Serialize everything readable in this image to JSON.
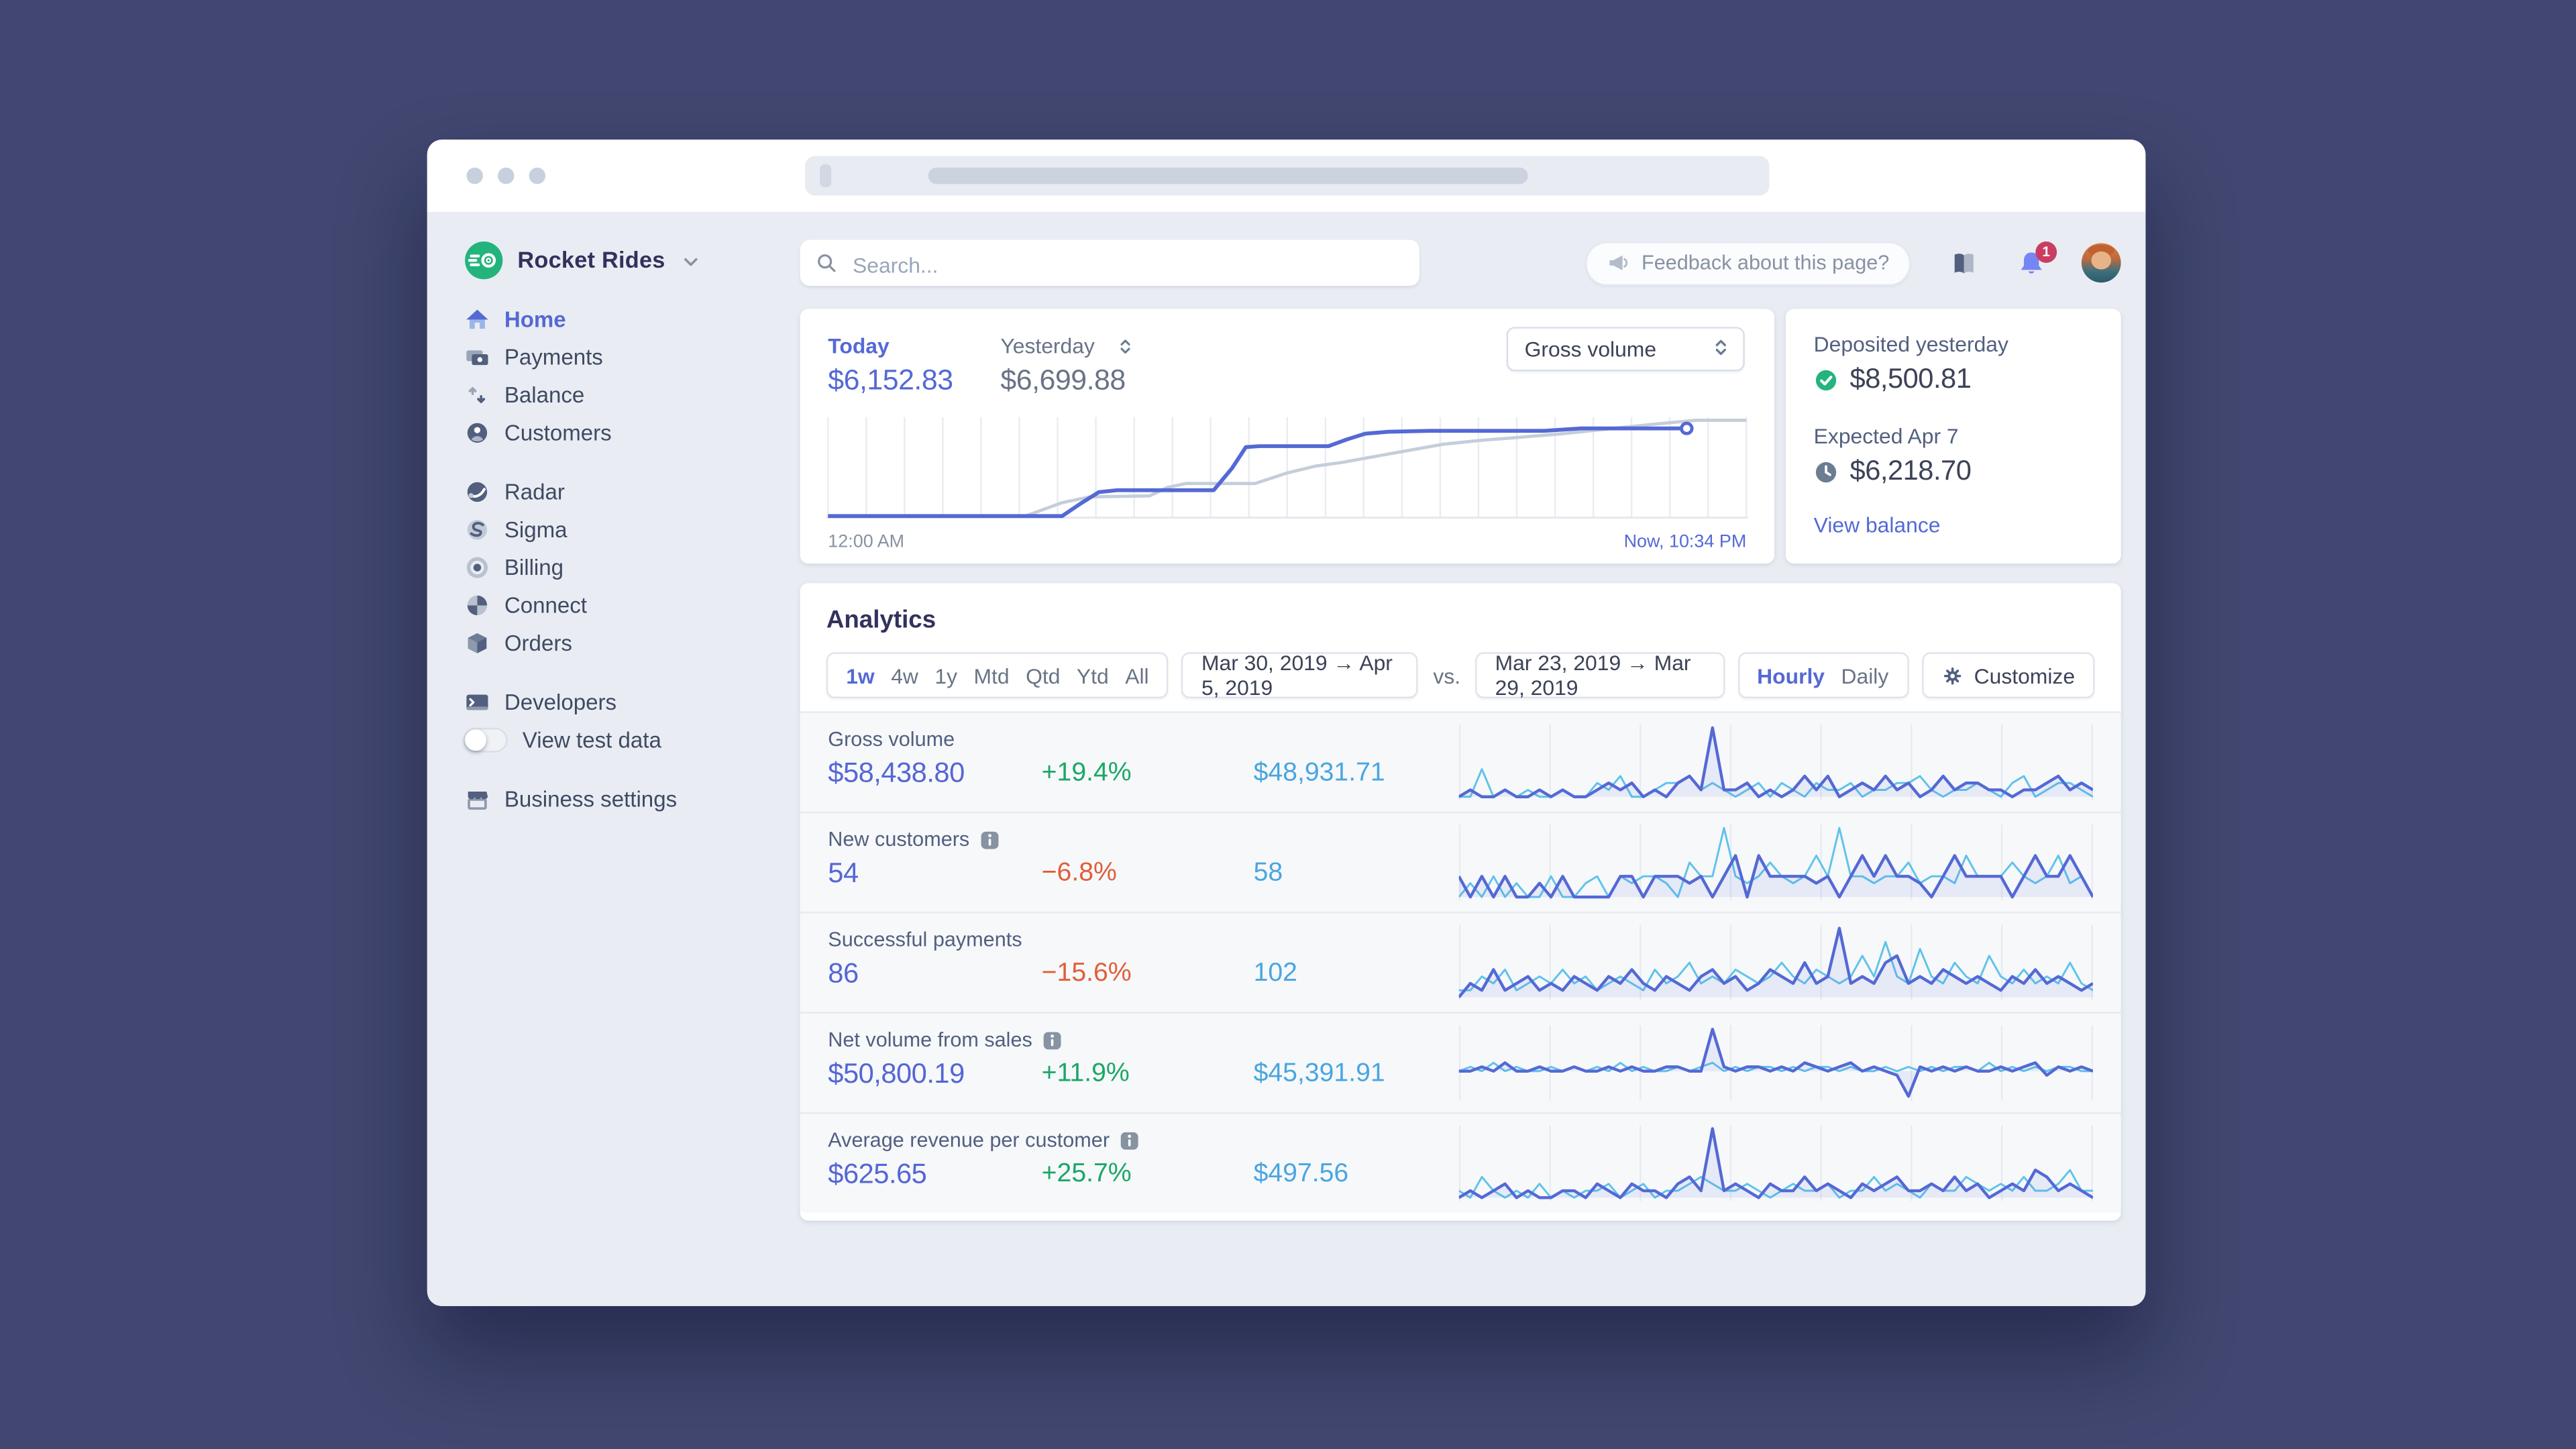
{
  "sidebar": {
    "account_name": "Rocket Rides",
    "nav_main": [
      {
        "label": "Home",
        "icon": "home",
        "active": true
      },
      {
        "label": "Payments",
        "icon": "payments"
      },
      {
        "label": "Balance",
        "icon": "balance"
      },
      {
        "label": "Customers",
        "icon": "customers"
      }
    ],
    "nav_products": [
      {
        "label": "Radar",
        "icon": "radar"
      },
      {
        "label": "Sigma",
        "icon": "sigma"
      },
      {
        "label": "Billing",
        "icon": "billing"
      },
      {
        "label": "Connect",
        "icon": "connect"
      },
      {
        "label": "Orders",
        "icon": "orders"
      }
    ],
    "nav_dev": [
      {
        "label": "Developers",
        "icon": "developers"
      },
      {
        "label": "View test data",
        "toggle": true,
        "toggle_on": false
      }
    ],
    "nav_bottom": [
      {
        "label": "Business settings",
        "icon": "store"
      }
    ]
  },
  "header": {
    "search_placeholder": "Search...",
    "feedback_label": "Feedback about this page?",
    "notification_count": "1"
  },
  "overview": {
    "today_label": "Today",
    "today_value": "$6,152.83",
    "yesterday_label": "Yesterday",
    "yesterday_value": "$6,699.88",
    "metric_select": "Gross volume",
    "x_start_label": "12:00 AM",
    "x_end_label": "Now, 10:34 PM",
    "chart": {
      "today": [
        [
          0,
          0
        ],
        [
          0.255,
          0
        ],
        [
          0.275,
          0.13
        ],
        [
          0.295,
          0.25
        ],
        [
          0.315,
          0.27
        ],
        [
          0.42,
          0.27
        ],
        [
          0.44,
          0.5
        ],
        [
          0.455,
          0.72
        ],
        [
          0.47,
          0.73
        ],
        [
          0.545,
          0.73
        ],
        [
          0.565,
          0.8
        ],
        [
          0.585,
          0.86
        ],
        [
          0.61,
          0.88
        ],
        [
          0.655,
          0.89
        ],
        [
          0.78,
          0.89
        ],
        [
          0.82,
          0.915
        ],
        [
          0.935,
          0.915
        ]
      ],
      "yesterday": [
        [
          0,
          0
        ],
        [
          0.215,
          0
        ],
        [
          0.255,
          0.14
        ],
        [
          0.285,
          0.2
        ],
        [
          0.35,
          0.21
        ],
        [
          0.37,
          0.3
        ],
        [
          0.39,
          0.34
        ],
        [
          0.465,
          0.34
        ],
        [
          0.5,
          0.45
        ],
        [
          0.53,
          0.52
        ],
        [
          0.56,
          0.56
        ],
        [
          0.6,
          0.63
        ],
        [
          0.635,
          0.69
        ],
        [
          0.67,
          0.75
        ],
        [
          0.71,
          0.79
        ],
        [
          0.75,
          0.82
        ],
        [
          0.8,
          0.86
        ],
        [
          0.85,
          0.91
        ],
        [
          0.9,
          0.96
        ],
        [
          0.945,
          1
        ],
        [
          1,
          1
        ]
      ]
    }
  },
  "balance_panel": {
    "deposited_label": "Deposited yesterday",
    "deposited_value": "$8,500.81",
    "expected_label": "Expected Apr 7",
    "expected_value": "$6,218.70",
    "link_label": "View balance"
  },
  "analytics": {
    "title": "Analytics",
    "intervals": [
      "1w",
      "4w",
      "1y",
      "Mtd",
      "Qtd",
      "Ytd",
      "All"
    ],
    "active_interval": "1w",
    "range_primary": "Mar 30, 2019 → Apr 5, 2019",
    "vs_label": "vs.",
    "range_compare": "Mar 23, 2019 → Mar 29, 2019",
    "granularities": [
      "Hourly",
      "Daily"
    ],
    "active_granularity": "Hourly",
    "customize_label": "Customize",
    "rows": [
      {
        "label": "Gross volume",
        "info": false,
        "value": "$58,438.80",
        "change": "+19.4%",
        "dir": "up",
        "compare": "$48,931.71",
        "spark_current": [
          0,
          1,
          0,
          0,
          1,
          0,
          0,
          1,
          0,
          1,
          0,
          0,
          1,
          2,
          1,
          2,
          0,
          1,
          0,
          2,
          3,
          1,
          10,
          1,
          1,
          2,
          0,
          1,
          0,
          1,
          3,
          1,
          3,
          0,
          1,
          2,
          1,
          3,
          1,
          2,
          0,
          1,
          3,
          1,
          2,
          2,
          1,
          1,
          0,
          1,
          1,
          2,
          3,
          1,
          2,
          1
        ],
        "spark_compare": [
          0,
          0,
          4,
          0,
          1,
          0,
          1,
          0,
          0,
          1,
          0,
          0,
          2,
          1,
          3,
          0,
          0,
          1,
          2,
          2,
          3,
          1,
          2,
          1,
          0,
          1,
          2,
          0,
          2,
          1,
          0,
          2,
          1,
          1,
          2,
          0,
          1,
          1,
          2,
          2,
          3,
          1,
          0,
          1,
          1,
          2,
          1,
          0,
          2,
          3,
          0,
          1,
          2,
          2,
          1,
          0
        ]
      },
      {
        "label": "New customers",
        "info": true,
        "value": "54",
        "change": "−6.8%",
        "dir": "down",
        "compare": "58",
        "spark_current": [
          3,
          0,
          3,
          0,
          3,
          0,
          0,
          2,
          0,
          3,
          0,
          0,
          0,
          0,
          3,
          3,
          0,
          3,
          3,
          3,
          2,
          3,
          0,
          3,
          6,
          0,
          6,
          3,
          3,
          3,
          3,
          2,
          3,
          0,
          3,
          6,
          3,
          6,
          3,
          3,
          2,
          0,
          3,
          6,
          3,
          3,
          3,
          3,
          0,
          3,
          6,
          3,
          3,
          6,
          3,
          0
        ],
        "spark_compare": [
          0,
          2,
          0,
          3,
          0,
          2,
          0,
          0,
          3,
          0,
          0,
          2,
          3,
          0,
          3,
          2,
          3,
          3,
          2,
          0,
          5,
          3,
          3,
          10,
          3,
          2,
          3,
          5,
          3,
          2,
          3,
          6,
          3,
          10,
          3,
          3,
          2,
          3,
          3,
          5,
          2,
          3,
          3,
          2,
          6,
          3,
          3,
          3,
          5,
          3,
          2,
          3,
          6,
          2,
          3,
          0
        ]
      },
      {
        "label": "Successful payments",
        "info": false,
        "value": "86",
        "change": "−15.6%",
        "dir": "down",
        "compare": "102",
        "spark_current": [
          0,
          2,
          1,
          4,
          1,
          2,
          3,
          1,
          2,
          1,
          3,
          2,
          1,
          3,
          2,
          4,
          2,
          1,
          3,
          2,
          1,
          3,
          4,
          2,
          3,
          1,
          2,
          4,
          3,
          2,
          5,
          2,
          3,
          10,
          2,
          3,
          2,
          5,
          6,
          2,
          3,
          2,
          4,
          3,
          2,
          3,
          2,
          1,
          3,
          2,
          4,
          2,
          3,
          2,
          1,
          2
        ],
        "spark_compare": [
          1,
          1,
          3,
          2,
          4,
          1,
          2,
          3,
          2,
          4,
          2,
          3,
          1,
          2,
          3,
          2,
          1,
          4,
          2,
          3,
          5,
          2,
          3,
          2,
          4,
          3,
          2,
          3,
          5,
          3,
          2,
          4,
          3,
          2,
          3,
          6,
          3,
          8,
          3,
          2,
          7,
          3,
          2,
          5,
          3,
          2,
          6,
          3,
          2,
          4,
          2,
          3,
          2,
          5,
          2,
          1
        ]
      },
      {
        "label": "Net volume from sales",
        "info": true,
        "value": "$50,800.19",
        "change": "+11.9%",
        "dir": "up",
        "compare": "$45,391.91",
        "spark_current": [
          0,
          0,
          1,
          0,
          2,
          0,
          0,
          1,
          0,
          0,
          1,
          0,
          0,
          1,
          0,
          1,
          0,
          0,
          1,
          1,
          0,
          0,
          10,
          1,
          0,
          1,
          1,
          0,
          1,
          0,
          2,
          1,
          0,
          1,
          2,
          0,
          1,
          0,
          -1,
          -6,
          1,
          0,
          1,
          0,
          1,
          0,
          0,
          1,
          0,
          1,
          2,
          -1,
          1,
          0,
          1,
          0
        ],
        "spark_compare": [
          0,
          1,
          0,
          2,
          0,
          1,
          0,
          0,
          1,
          0,
          1,
          0,
          1,
          0,
          2,
          0,
          1,
          0,
          0,
          1,
          0,
          1,
          2,
          0,
          1,
          0,
          1,
          1,
          0,
          1,
          0,
          1,
          1,
          0,
          1,
          0,
          0,
          1,
          0,
          1,
          0,
          1,
          0,
          1,
          1,
          0,
          2,
          0,
          1,
          0,
          1,
          0,
          1,
          1,
          0,
          0
        ]
      },
      {
        "label": "Average revenue per customer",
        "info": true,
        "value": "$625.65",
        "change": "+25.7%",
        "dir": "up",
        "compare": "$497.56",
        "spark_current": [
          0,
          1,
          0,
          1,
          2,
          0,
          1,
          0,
          0,
          1,
          1,
          0,
          2,
          1,
          0,
          2,
          1,
          1,
          0,
          2,
          3,
          1,
          10,
          1,
          2,
          1,
          0,
          2,
          1,
          1,
          3,
          1,
          2,
          1,
          0,
          2,
          1,
          2,
          3,
          1,
          1,
          2,
          1,
          3,
          1,
          2,
          0,
          1,
          2,
          1,
          4,
          3,
          1,
          2,
          1,
          0
        ],
        "spark_compare": [
          1,
          0,
          3,
          1,
          0,
          1,
          0,
          2,
          0,
          1,
          0,
          1,
          1,
          2,
          0,
          1,
          2,
          0,
          1,
          1,
          2,
          3,
          2,
          1,
          1,
          2,
          1,
          0,
          1,
          2,
          1,
          1,
          2,
          0,
          1,
          1,
          3,
          1,
          2,
          1,
          0,
          2,
          1,
          1,
          3,
          2,
          1,
          2,
          1,
          3,
          1,
          1,
          2,
          4,
          1,
          1
        ]
      }
    ]
  },
  "colors": {
    "indigo": "#5469d4",
    "green": "#1ba766",
    "orange": "#e25d38",
    "compare_blue": "#4aa5e0",
    "spark_cyan": "#5fc3ea",
    "brand_green": "#23b47e",
    "desktop_bg": "#414770",
    "app_bg": "#e9edf3"
  }
}
